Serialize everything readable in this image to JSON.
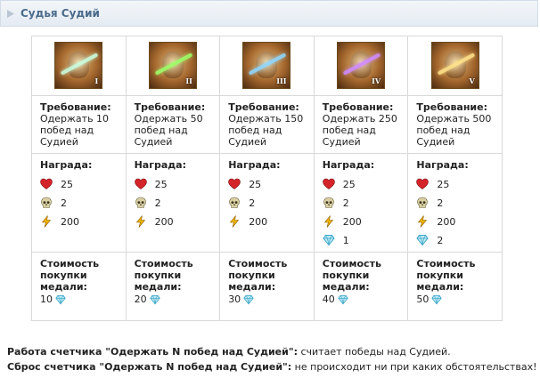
{
  "header": {
    "title": "Судья Судий"
  },
  "labels": {
    "requirement": "Требование:",
    "reward": "Награда:",
    "cost": "Стоимость покупки медали:"
  },
  "colors": {
    "heart": "#d4242a",
    "skull": "#d8cfa4",
    "bolt": "#f0b400",
    "gem": "#3aa6c8"
  },
  "medals": [
    {
      "numeral": "I",
      "sword_color": "#c9ffe0",
      "requirement": "Одержать 10 побед над Судией",
      "rewards": [
        {
          "icon": "heart-icon",
          "value": "25"
        },
        {
          "icon": "skull-icon",
          "value": "2"
        },
        {
          "icon": "bolt-icon",
          "value": "200"
        }
      ],
      "cost": "10"
    },
    {
      "numeral": "II",
      "sword_color": "#9dff6a",
      "requirement": "Одержать 50 побед над Судией",
      "rewards": [
        {
          "icon": "heart-icon",
          "value": "25"
        },
        {
          "icon": "skull-icon",
          "value": "2"
        },
        {
          "icon": "bolt-icon",
          "value": "200"
        }
      ],
      "cost": "20"
    },
    {
      "numeral": "III",
      "sword_color": "#8fd8ff",
      "requirement": "Одержать 150 побед над Судией",
      "rewards": [
        {
          "icon": "heart-icon",
          "value": "25"
        },
        {
          "icon": "skull-icon",
          "value": "2"
        },
        {
          "icon": "bolt-icon",
          "value": "200"
        }
      ],
      "cost": "30"
    },
    {
      "numeral": "IV",
      "sword_color": "#d08cff",
      "requirement": "Одержать 250 побед над Судией",
      "rewards": [
        {
          "icon": "heart-icon",
          "value": "25"
        },
        {
          "icon": "skull-icon",
          "value": "2"
        },
        {
          "icon": "bolt-icon",
          "value": "200"
        },
        {
          "icon": "gem-icon",
          "value": "1"
        }
      ],
      "cost": "40"
    },
    {
      "numeral": "V",
      "sword_color": "#ffe38a",
      "requirement": "Одержать 500 побед над Судией",
      "rewards": [
        {
          "icon": "heart-icon",
          "value": "25"
        },
        {
          "icon": "skull-icon",
          "value": "2"
        },
        {
          "icon": "bolt-icon",
          "value": "200"
        },
        {
          "icon": "gem-icon",
          "value": "2"
        }
      ],
      "cost": "50"
    }
  ],
  "notes": [
    {
      "bold": "Работа счетчика \"Одержать N побед над Судией\":",
      "text": " считает победы над Судией."
    },
    {
      "bold": "Сброс счетчика \"Одержать N побед над Судией\":",
      "text": " не происходит ни при каких обстоятельствах!"
    }
  ]
}
